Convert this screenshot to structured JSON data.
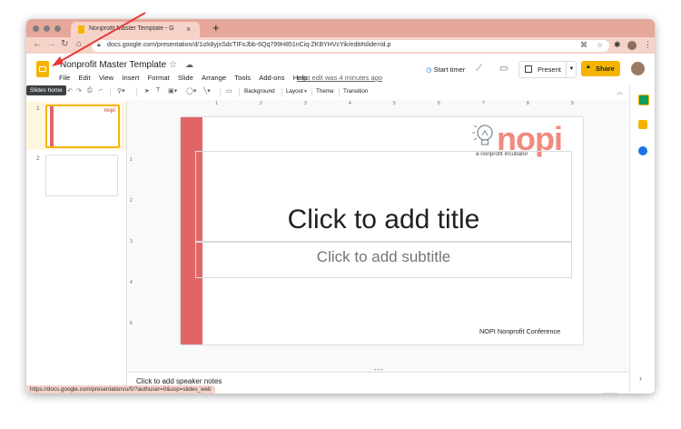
{
  "browser": {
    "tab_title": "Nonprofit Master Template - G",
    "tab_close": "×",
    "new_tab": "+",
    "url": "docs.google.com/presentation/d/1izk8yjxSdcTIFoJbb-6Qq799H851nCiq-ZKBYHVcYik/edit#slide=id.p",
    "status_url": "https://docs.google.com/presentation/u/0/?authuser=0&usp=slides_web",
    "accent": "#e5a89a"
  },
  "docs": {
    "title": "Nonprofit Master Template",
    "tooltip": "Slides home",
    "menu": [
      "File",
      "Edit",
      "View",
      "Insert",
      "Format",
      "Slide",
      "Arrange",
      "Tools",
      "Add-ons",
      "Help"
    ],
    "last_edit": "Last edit was 4 minutes ago",
    "start_timer": "Start timer",
    "present": "Present",
    "share": "Share",
    "brand_color": "#f4b400"
  },
  "toolbar": {
    "background": "Background",
    "layout": "Layout",
    "theme": "Theme",
    "transition": "Transition"
  },
  "filmstrip": {
    "slides": [
      {
        "number": "1",
        "selected": true
      },
      {
        "number": "2",
        "selected": false
      }
    ],
    "thumb_logo": "nopi"
  },
  "rulers": {
    "h_labels": [
      "1",
      "2",
      "3",
      "4",
      "5",
      "6",
      "7",
      "8",
      "9"
    ],
    "v_labels": [
      "1",
      "2",
      "3",
      "4",
      "5"
    ]
  },
  "slide": {
    "logo_text": "nopi",
    "logo_sub": "a nonprofit incubator",
    "title": "Click to add title",
    "subtitle": "Click to add subtitle",
    "footer": "NOPI Nonprofit Conference",
    "accent": "#e06666"
  },
  "notes": {
    "placeholder": "Click to add speaker notes"
  }
}
